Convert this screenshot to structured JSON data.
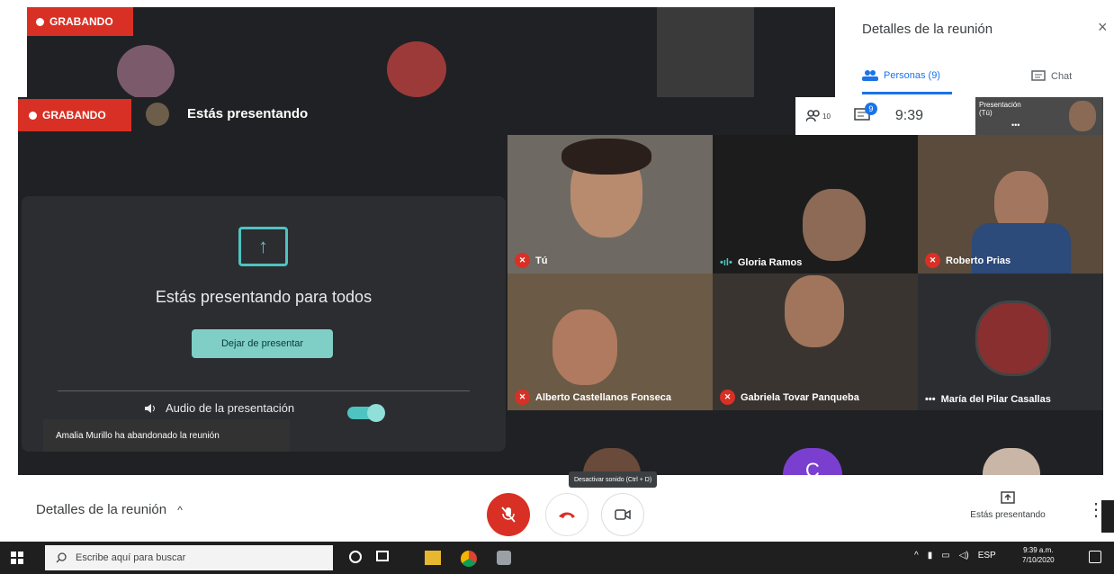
{
  "background_window": {
    "recording_label": "GRABANDO",
    "panel_title": "Detalles de la reunión",
    "close_glyph": "×",
    "tab_people": "Personas (9)",
    "tab_chat": "Chat"
  },
  "header": {
    "recording_label": "GRABANDO",
    "presenting_status": "Estás presentando"
  },
  "toolbar": {
    "people_count": "10",
    "chat_badge": "9",
    "time": "9:39",
    "self_view_label": "Presentación (Tú)",
    "self_view_dots": "•••"
  },
  "presentation": {
    "message": "Estás presentando para todos",
    "stop_button": "Dejar de presentar",
    "audio_label": "Audio de la presentación"
  },
  "toast": "Amalia Murillo ha abandonado la reunión",
  "participants": [
    {
      "name": "Tú",
      "mic": "off"
    },
    {
      "name": "Gloria Ramos",
      "mic": "speaking"
    },
    {
      "name": "Roberto Prias",
      "mic": "off"
    },
    {
      "name": "Alberto Castellanos Fonseca",
      "mic": "off"
    },
    {
      "name": "Gabriela Tovar Panqueba",
      "mic": "off"
    },
    {
      "name": "María del Pilar Casallas",
      "mic": "more"
    }
  ],
  "partial_tile_initial": "C",
  "bottom_bar": {
    "meeting_details": "Detalles de la reunión",
    "details_chevron": "^",
    "mic_tooltip": "Desactivar sonido (Ctrl + D)",
    "presenting_label": "Estás presentando",
    "more_glyph": "⋮"
  },
  "taskbar": {
    "search_placeholder": "Escribe aquí para buscar",
    "language": "ESP",
    "time": "9:39 a.m.",
    "date": "7/10/2020"
  },
  "colors": {
    "recording_red": "#d93025",
    "accent_teal": "#4fc3c0",
    "meet_dark": "#202124",
    "link_blue": "#1a73e8"
  }
}
